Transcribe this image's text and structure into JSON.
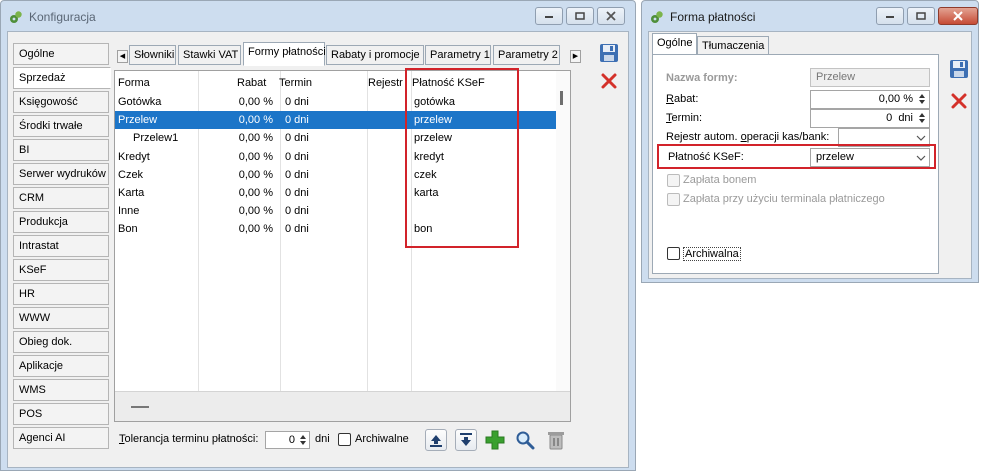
{
  "config_window": {
    "title": "Konfiguracja",
    "nav_items": [
      "Ogólne",
      "Sprzedaż",
      "Księgowość",
      "Środki trwałe",
      "BI",
      "Serwer wydruków",
      "CRM",
      "Produkcja",
      "Intrastat",
      "KSeF",
      "HR",
      "WWW",
      "Obieg dok.",
      "Aplikacje",
      "WMS",
      "POS",
      "Agenci AI"
    ],
    "active_nav": "Sprzedaż",
    "tabs": [
      "Słowniki",
      "Stawki VAT",
      "Formy płatności",
      "Rabaty i promocje",
      "Parametry 1",
      "Parametry 2"
    ],
    "active_tab": "Formy płatności",
    "grid": {
      "columns": [
        "Forma",
        "Rabat",
        "Termin",
        "Rejestr",
        "Płatność KSeF"
      ],
      "rows": [
        {
          "forma": "Gotówka",
          "rabat": "0,00 %",
          "termin": "0 dni",
          "rejestr": "",
          "ksef": "gotówka",
          "selected": false,
          "indent": false
        },
        {
          "forma": "Przelew",
          "rabat": "0,00 %",
          "termin": "0 dni",
          "rejestr": "",
          "ksef": "przelew",
          "selected": true,
          "indent": false
        },
        {
          "forma": "Przelew1",
          "rabat": "0,00 %",
          "termin": "0 dni",
          "rejestr": "",
          "ksef": "przelew",
          "selected": false,
          "indent": true
        },
        {
          "forma": "Kredyt",
          "rabat": "0,00 %",
          "termin": "0 dni",
          "rejestr": "",
          "ksef": "kredyt",
          "selected": false,
          "indent": false
        },
        {
          "forma": "Czek",
          "rabat": "0,00 %",
          "termin": "0 dni",
          "rejestr": "",
          "ksef": "czek",
          "selected": false,
          "indent": false
        },
        {
          "forma": "Karta",
          "rabat": "0,00 %",
          "termin": "0 dni",
          "rejestr": "",
          "ksef": "karta",
          "selected": false,
          "indent": false
        },
        {
          "forma": "Inne",
          "rabat": "0,00 %",
          "termin": "0 dni",
          "rejestr": "",
          "ksef": "",
          "selected": false,
          "indent": false
        },
        {
          "forma": "Bon",
          "rabat": "0,00 %",
          "termin": "0 dni",
          "rejestr": "",
          "ksef": "bon",
          "selected": false,
          "indent": false
        }
      ]
    },
    "tolerance_label": "Tolerancja terminu płatności:",
    "tolerance_value": "0",
    "tolerance_unit": "dni",
    "archive_label": "Archiwalne",
    "toolbar_icons": [
      "import-icon",
      "export-icon",
      "add-icon",
      "preview-icon",
      "delete-icon"
    ]
  },
  "payment_dialog": {
    "title": "Forma płatności",
    "tabs": [
      "Ogólne",
      "Tłumaczenia"
    ],
    "active_tab": "Ogólne",
    "name_label": "Nazwa formy:",
    "name_value": "Przelew",
    "rabat_label": "Rabat:",
    "rabat_value": "0,00 %",
    "termin_label": "Termin:",
    "termin_value": "0",
    "termin_unit": "dni",
    "rejestr_label": "Rejestr autom. operacji kas/bank:",
    "rejestr_value": "",
    "ksef_label": "Płatność KSeF:",
    "ksef_value": "przelew",
    "bon_label": "Zapłata bonem",
    "terminal_label": "Zapłata przy użyciu terminala płatniczego",
    "archive_label": "Archiwalna"
  },
  "colors": {
    "selection": "#1c75c8",
    "highlight_box": "#d2232a",
    "window_frame": "#cdddef"
  }
}
